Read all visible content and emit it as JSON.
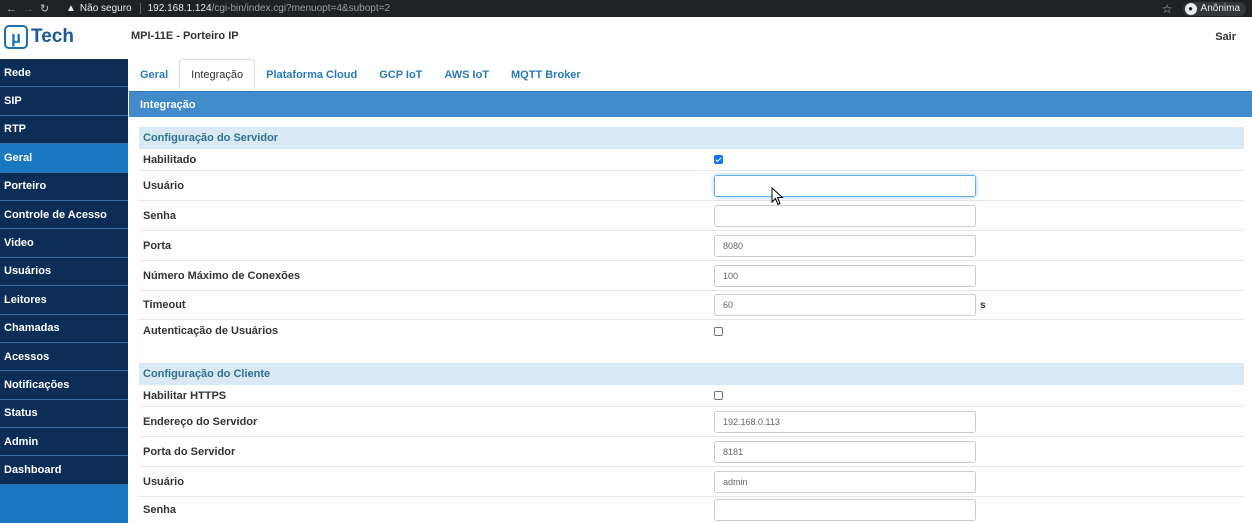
{
  "browser": {
    "warning_label": "Não seguro",
    "url_host": "192.168.1.124",
    "url_path": "/cgi-bin/index.cgi?menuopt=4&subopt=2",
    "profile_label": "Anônima"
  },
  "header": {
    "logo_symbol": "µ",
    "logo_text": "Tech",
    "title": "MPI-11E - Porteiro IP",
    "logout": "Sair"
  },
  "sidebar": {
    "items": [
      {
        "label": "Rede"
      },
      {
        "label": "SIP"
      },
      {
        "label": "RTP"
      },
      {
        "label": "Geral",
        "active": true
      },
      {
        "label": "Porteiro"
      },
      {
        "label": "Controle de Acesso"
      },
      {
        "label": "Video"
      },
      {
        "label": "Usuários"
      },
      {
        "label": "Leitores"
      },
      {
        "label": "Chamadas"
      },
      {
        "label": "Acessos"
      },
      {
        "label": "Notificações"
      },
      {
        "label": "Status"
      },
      {
        "label": "Admin"
      },
      {
        "label": "Dashboard"
      }
    ]
  },
  "tabs": [
    {
      "label": "Geral"
    },
    {
      "label": "Integração",
      "active": true
    },
    {
      "label": "Plataforma Cloud"
    },
    {
      "label": "GCP IoT"
    },
    {
      "label": "AWS IoT"
    },
    {
      "label": "MQTT Broker"
    }
  ],
  "panel": {
    "title": "Integração"
  },
  "server_config": {
    "title": "Configuração do Servidor",
    "enabled_label": "Habilitado",
    "enabled": true,
    "user_label": "Usuário",
    "user_value": "",
    "password_label": "Senha",
    "password_value": "",
    "port_label": "Porta",
    "port_value": "8080",
    "max_conn_label": "Número Máximo de Conexões",
    "max_conn_value": "100",
    "timeout_label": "Timeout",
    "timeout_value": "60",
    "timeout_unit": "s",
    "auth_label": "Autenticação de Usuários",
    "auth_enabled": false
  },
  "client_config": {
    "title": "Configuração do Cliente",
    "https_label": "Habilitar HTTPS",
    "https_enabled": false,
    "server_address_label": "Endereço do Servidor",
    "server_address_value": "192.168.0.113",
    "server_port_label": "Porta do Servidor",
    "server_port_value": "8181",
    "user_label": "Usuário",
    "user_value": "admin",
    "password_label": "Senha",
    "password_value": ""
  },
  "colors": {
    "sidebar_dark": "#0c2d55",
    "sidebar_active": "#1a78c2",
    "panel_header": "#428bca",
    "section_bg": "#d9e9f5",
    "tab_link": "#2a7ab8"
  }
}
